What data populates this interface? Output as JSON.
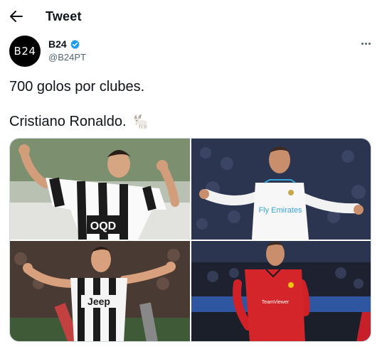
{
  "header": {
    "title": "Tweet",
    "back_icon": "arrow-left-icon"
  },
  "author": {
    "avatar_text": "B24",
    "display_name": "B24",
    "handle": "@B24PT",
    "verified": true,
    "verified_color": "#1d9bf0"
  },
  "more_icon": "more-horizontal-icon",
  "tweet": {
    "line1": "700 golos por clubes.",
    "line2": "Cristiano Ronaldo.",
    "emoji_icon": "goat-icon"
  },
  "photos": [
    {
      "jersey_text": "OQD",
      "jersey_colors": [
        "#1b1b1b",
        "#ffffff"
      ]
    },
    {
      "jersey_text": "Fly Emirates",
      "jersey_colors": [
        "#ffffff",
        "#3aa4d9"
      ]
    },
    {
      "jersey_text": "Jeep",
      "jersey_colors": [
        "#1b1b1b",
        "#ffffff"
      ]
    },
    {
      "jersey_text": "TeamViewer",
      "jersey_colors": [
        "#d4262a",
        "#1a1a1a"
      ]
    }
  ],
  "colors": {
    "text": "#0f1419",
    "secondary": "#536471",
    "accent": "#1d9bf0"
  }
}
